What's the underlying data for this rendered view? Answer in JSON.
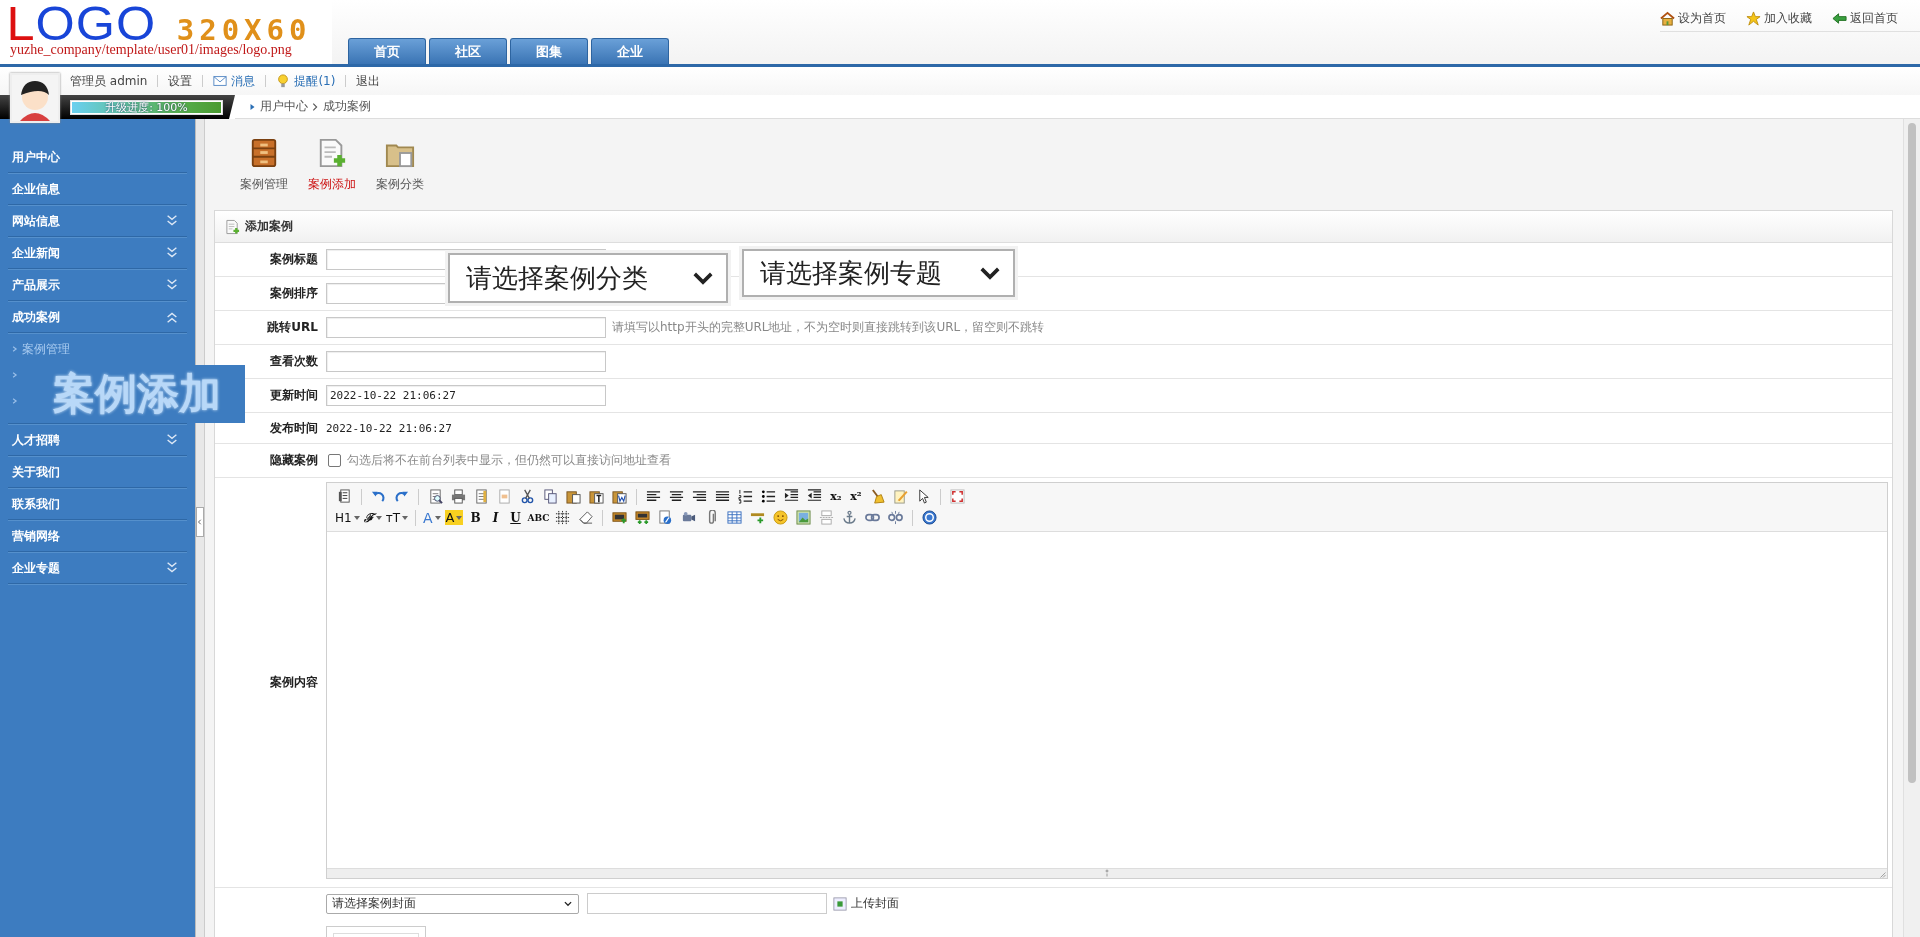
{
  "logo": {
    "mark": "LOGO",
    "size": "320X60",
    "path": "yuzhe_company/template/user01/images/logo.png"
  },
  "nav_tabs": [
    "首页",
    "社区",
    "图集",
    "企业"
  ],
  "top_links": [
    {
      "label": "设为首页",
      "kind": "home"
    },
    {
      "label": "加入收藏",
      "kind": "star"
    },
    {
      "label": "返回首页",
      "kind": "back"
    }
  ],
  "user_bar": {
    "user": "管理员 admin",
    "links": [
      {
        "label": "设置",
        "kind": "text"
      },
      {
        "label": "消息",
        "kind": "mail"
      },
      {
        "label": "提醒(1)",
        "kind": "bulb"
      },
      {
        "label": "退出",
        "kind": "text"
      }
    ],
    "progress": {
      "label": "升级进度: 100%",
      "level": 1
    }
  },
  "breadcrumb": [
    "用户中心",
    "成功案例"
  ],
  "sidebar": {
    "items": [
      {
        "label": "用户中心"
      },
      {
        "label": "企业信息"
      },
      {
        "label": "网站信息",
        "expanded": false
      },
      {
        "label": "企业新闻",
        "expanded": false
      },
      {
        "label": "产品展示",
        "expanded": false
      },
      {
        "label": "成功案例",
        "expanded": true,
        "children": [
          {
            "label": "案例管理",
            "kind": "link"
          },
          {
            "kind": "covered"
          },
          {
            "kind": "covered"
          }
        ]
      },
      {
        "label": "人才招聘",
        "expanded": false
      },
      {
        "label": "关于我们"
      },
      {
        "label": "联系我们"
      },
      {
        "label": "营销网络"
      },
      {
        "label": "企业专题",
        "expanded": false
      }
    ]
  },
  "tool_icons": [
    {
      "label": "案例管理",
      "kind": "cabinet",
      "selected": false
    },
    {
      "label": "案例添加",
      "kind": "add",
      "selected": true
    },
    {
      "label": "案例分类",
      "kind": "folder",
      "selected": false
    }
  ],
  "panel": {
    "title": "添加案例",
    "rows": [
      {
        "label": "案例标题",
        "kind": "input"
      },
      {
        "label": "案例排序",
        "kind": "input"
      },
      {
        "label": "跳转URL",
        "kind": "input",
        "hint": "请填写以http开头的完整URL地址，不为空时则直接跳转到该URL，留空则不跳转"
      },
      {
        "label": "查看次数",
        "kind": "input"
      },
      {
        "label": "更新时间",
        "kind": "input",
        "value": "2022-10-22 21:06:27"
      },
      {
        "label": "发布时间",
        "kind": "text",
        "value": "2022-10-22 21:06:27"
      },
      {
        "label": "隐藏案例",
        "kind": "checkbox",
        "checked": false,
        "hint": "勾选后将不在前台列表中显示，但仍然可以直接访问地址查看"
      },
      {
        "label": "案例内容",
        "kind": "editor",
        "toolbar_labels": [
          "x₂",
          "x²",
          "H1",
          "ℱ",
          "ᴛT",
          "A",
          "A",
          "B",
          "I",
          "U",
          "ABC"
        ]
      },
      {
        "kind": "cover",
        "select": "请选择案例封面",
        "button": "上传封面"
      }
    ]
  },
  "zoom_callouts": [
    {
      "kind": "select",
      "text": "请选择案例分类"
    },
    {
      "kind": "select",
      "text": "请选择案例专题"
    },
    {
      "kind": "label",
      "text": "案例添加"
    }
  ]
}
